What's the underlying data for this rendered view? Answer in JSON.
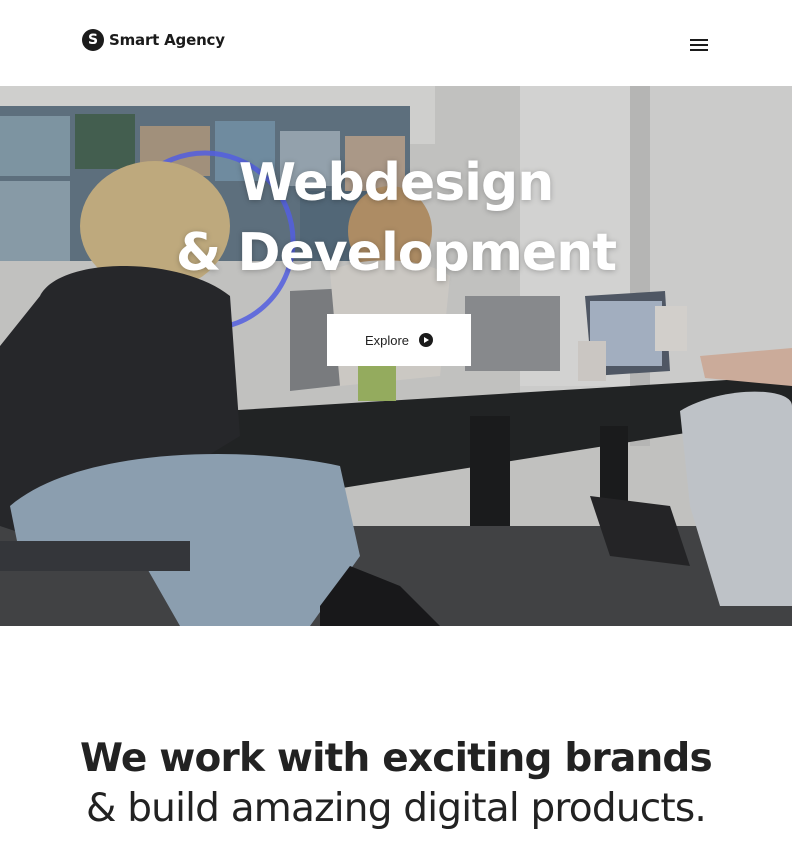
{
  "header": {
    "logo_letter": "S",
    "logo_text": "Smart Agency",
    "menu_icon": "hamburger-menu-icon"
  },
  "hero": {
    "title_line1": "Webdesign",
    "title_line2": "& Development",
    "explore_label": "Explore",
    "explore_icon": "play-circle-icon"
  },
  "intro": {
    "line1": "We work with exciting brands",
    "line2": "& build amazing digital products."
  }
}
